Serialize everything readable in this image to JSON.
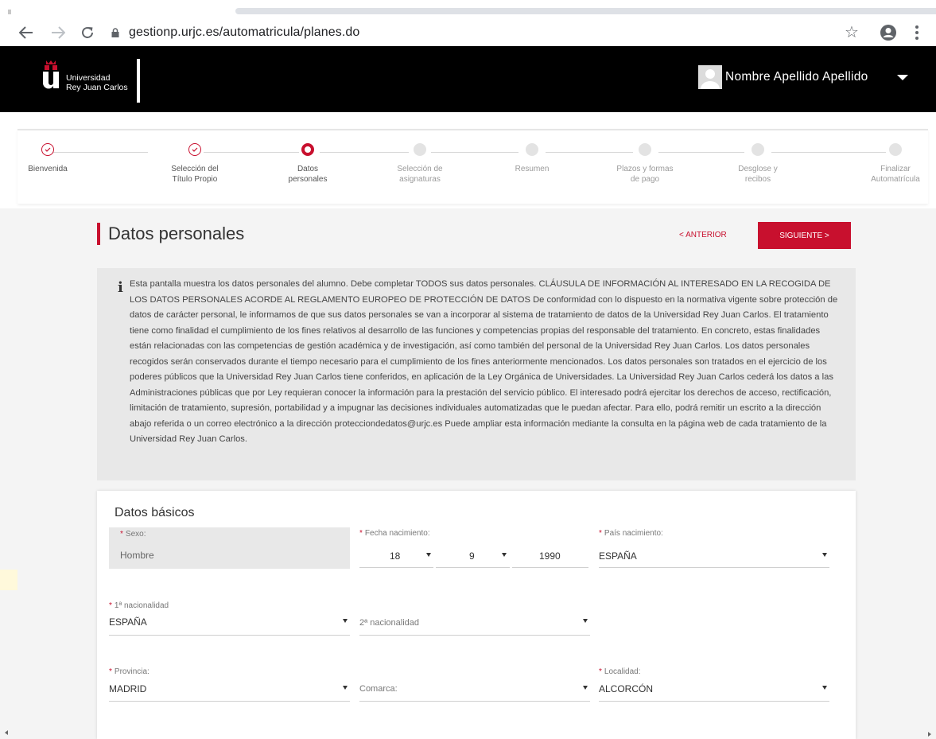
{
  "browser": {
    "url": "gestionp.urjc.es/automatricula/planes.do",
    "back_icon": "arrow-left-icon",
    "forward_icon": "arrow-right-icon",
    "reload_icon": "reload-icon",
    "star_glyph": "☆"
  },
  "header": {
    "university_line1": "Universidad",
    "university_line2": "Rey Juan Carlos",
    "user_name": "Nombre Apellido Apellido",
    "logo_color": "#c8102e"
  },
  "stepper": {
    "steps": [
      {
        "line1": "Bienvenida",
        "line2": "",
        "state": "done"
      },
      {
        "line1": "Selección del",
        "line2": "Título Propio",
        "state": "done"
      },
      {
        "line1": "Datos",
        "line2": "personales",
        "state": "current"
      },
      {
        "line1": "Selección de",
        "line2": "asignaturas",
        "state": "todo"
      },
      {
        "line1": "Resumen",
        "line2": "",
        "state": "todo"
      },
      {
        "line1": "Plazos y formas",
        "line2": "de pago",
        "state": "todo"
      },
      {
        "line1": "Desglose y",
        "line2": "recibos",
        "state": "todo"
      },
      {
        "line1": "Finalizar",
        "line2": "Automatrícula",
        "state": "todo"
      }
    ]
  },
  "page": {
    "title": "Datos personales",
    "prev_label": "< ANTERIOR",
    "next_label": "SIGUIENTE >",
    "info_text": "Esta pantalla muestra los datos personales del alumno. Debe completar TODOS sus datos personales. CLÁUSULA DE INFORMACIÓN AL INTERESADO EN LA RECOGIDA DE LOS DATOS PERSONALES ACORDE AL REGLAMENTO EUROPEO DE PROTECCIÓN DE DATOS De conformidad con lo dispuesto en la normativa vigente sobre protección de datos de carácter personal, le informamos de que sus datos personales se van a incorporar al sistema de tratamiento de datos de la Universidad Rey Juan Carlos. El tratamiento tiene como finalidad el cumplimiento de los fines relativos al desarrollo de las funciones y competencias propias del responsable del tratamiento. En concreto, estas finalidades están relacionadas con las competencias de gestión académica y de investigación, así como también del personal de la Universidad Rey Juan Carlos. Los datos personales recogidos serán conservados durante el tiempo necesario para el cumplimiento de los fines anteriormente mencionados. Los datos personales son tratados en el ejercicio de los poderes públicos que la Universidad Rey Juan Carlos tiene conferidos, en aplicación de la Ley Orgánica de Universidades. La Universidad Rey Juan Carlos cederá los datos a las Administraciones públicas que por Ley requieran conocer la información para la prestación del servicio público. El interesado podrá ejercitar los derechos de acceso, rectificación, limitación de tratamiento, supresión, portabilidad y a impugnar las decisiones individuales automatizadas que le puedan afectar. Para ello, podrá remitir un escrito a la dirección abajo referida o un correo electrónico a la dirección protecciondedatos@urjc.es Puede ampliar esta información mediante la consulta en la página web de cada tratamiento de la Universidad Rey Juan Carlos."
  },
  "form": {
    "section_title": "Datos básicos",
    "required_mark": "*",
    "sexo": {
      "label": "Sexo:",
      "value": "Hombre"
    },
    "fecha": {
      "label": "Fecha nacimiento:",
      "day": "18",
      "month": "9",
      "year": "1990"
    },
    "pais": {
      "label": "País nacimiento:",
      "value": "ESPAÑA"
    },
    "nac1": {
      "label": "1ª nacionalidad",
      "value": "ESPAÑA"
    },
    "nac2": {
      "placeholder": "2ª nacionalidad"
    },
    "provincia": {
      "label": "Provincia:",
      "value": "MADRID"
    },
    "comarca": {
      "placeholder": "Comarca:"
    },
    "localidad": {
      "label": "Localidad:",
      "value": "ALCORCÓN"
    }
  }
}
